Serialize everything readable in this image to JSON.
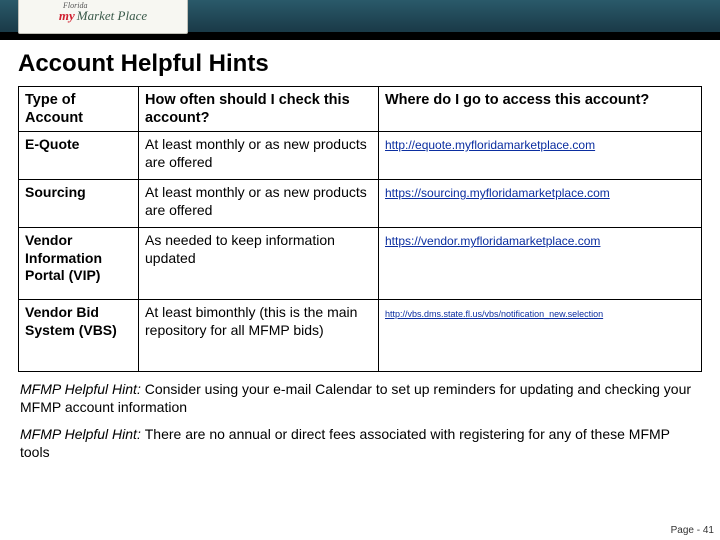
{
  "logo": {
    "my": "my",
    "florida": "Florida",
    "rest": "Market Place"
  },
  "title": "Account Helpful Hints",
  "table": {
    "headers": {
      "type": "Type of Account",
      "freq": "How often should I check this account?",
      "where": "Where do I go to access this account?"
    },
    "rows": [
      {
        "type": "E-Quote",
        "freq": "At least monthly or as new products are offered",
        "url": "http://equote.myfloridamarketplace.com",
        "small": false
      },
      {
        "type": "Sourcing",
        "freq": "At least monthly or as new products are offered",
        "url": "https://sourcing.myfloridamarketplace.com",
        "small": false
      },
      {
        "type": "Vendor Information Portal (VIP)",
        "freq": "As needed to keep information updated",
        "url": "https://vendor.myfloridamarketplace.com",
        "small": false
      },
      {
        "type": "Vendor Bid System (VBS)",
        "freq": "At least bimonthly (this is the main repository for all MFMP bids)",
        "url": "http://vbs.dms.state.fl.us/vbs/notification_new.selection",
        "small": true
      }
    ]
  },
  "hints": [
    {
      "lead": "MFMP Helpful Hint: ",
      "body": "Consider using your e-mail Calendar to set up reminders for updating and checking your MFMP account information"
    },
    {
      "lead": "MFMP Helpful Hint: ",
      "body": "There are no annual or direct fees associated with registering for any of these MFMP tools"
    }
  ],
  "page_label": "Page - 41"
}
